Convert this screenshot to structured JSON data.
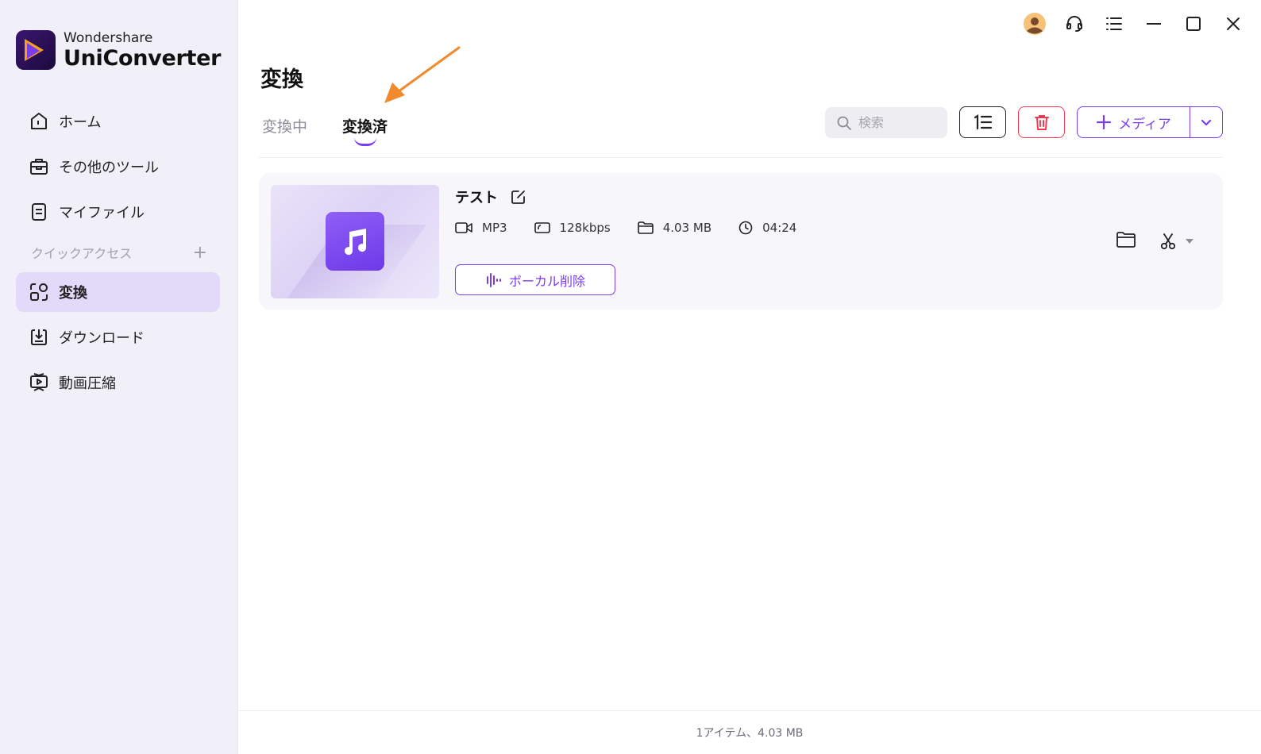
{
  "app": {
    "brand_top": "Wondershare",
    "brand_main": "UniConverter"
  },
  "sidebar": {
    "items": [
      {
        "label": "ホーム",
        "icon": "home-icon"
      },
      {
        "label": "その他のツール",
        "icon": "toolbox-icon"
      },
      {
        "label": "マイファイル",
        "icon": "file-icon"
      }
    ],
    "quick_access_label": "クイックアクセス",
    "quick_items": [
      {
        "label": "変換",
        "icon": "convert-icon",
        "active": true
      },
      {
        "label": "ダウンロード",
        "icon": "download-icon"
      },
      {
        "label": "動画圧縮",
        "icon": "compress-icon"
      }
    ]
  },
  "header": {
    "title": "変換",
    "tabs": [
      {
        "label": "変換中",
        "active": false
      },
      {
        "label": "変換済",
        "active": true
      }
    ]
  },
  "toolbar": {
    "search_placeholder": "検索",
    "add_media_label": "メディア"
  },
  "file": {
    "name": "テスト",
    "format": "MP3",
    "bitrate": "128kbps",
    "size": "4.03 MB",
    "duration": "04:24",
    "vocal_remove_label": "ボーカル削除"
  },
  "status": {
    "summary": "1アイテム、4.03 MB"
  },
  "colors": {
    "accent": "#7a3cf0",
    "delete": "#f3394e",
    "annotation_arrow": "#f08a2c",
    "sidebar_bg": "#f1eff8",
    "sidebar_active": "#e3d9f9"
  }
}
